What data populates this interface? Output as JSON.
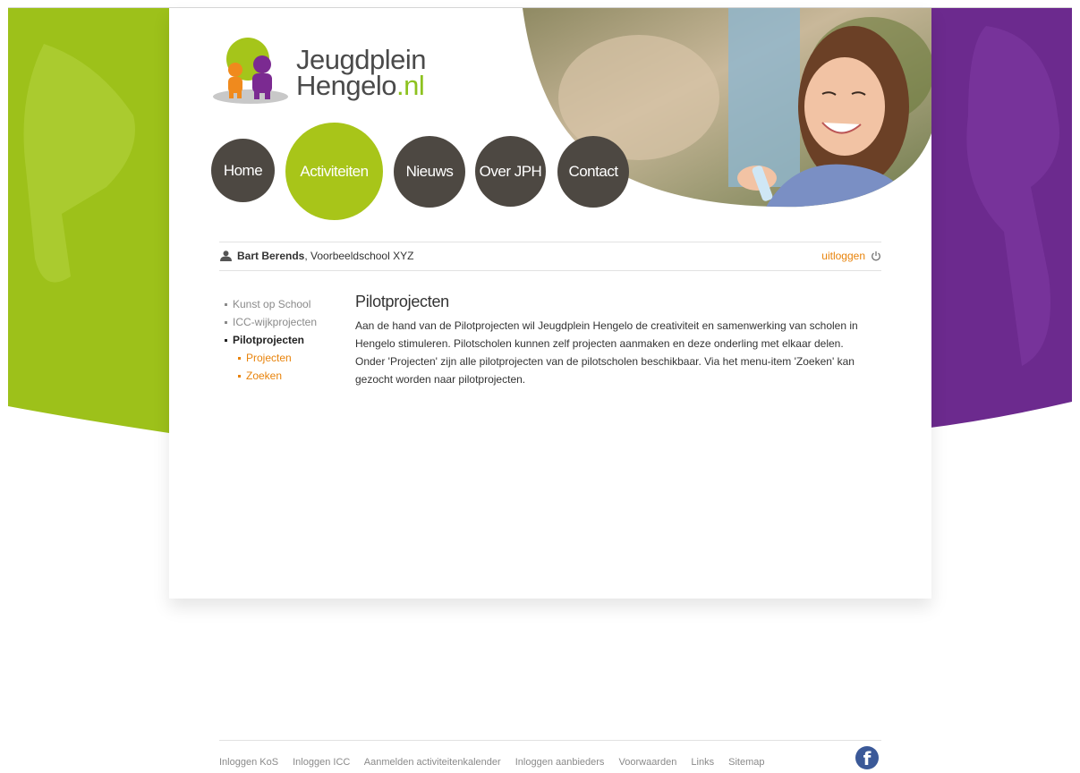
{
  "logo": {
    "line1": "Jeugdplein",
    "line2": "Hengelo",
    "suffix": ".nl"
  },
  "nav": [
    {
      "label": "Home",
      "active": false
    },
    {
      "label": "Activiteiten",
      "active": true
    },
    {
      "label": "Nieuws",
      "active": false
    },
    {
      "label": "Over JPH",
      "active": false
    },
    {
      "label": "Contact",
      "active": false
    }
  ],
  "user": {
    "name": "Bart Berends",
    "school": ", Voorbeeldschool XYZ",
    "logout": "uitloggen"
  },
  "sidebar": {
    "items": [
      {
        "label": "Kunst op School"
      },
      {
        "label": "ICC-wijkprojecten"
      },
      {
        "label": "Pilotprojecten"
      },
      {
        "label": "Projecten"
      },
      {
        "label": "Zoeken"
      }
    ]
  },
  "content": {
    "title": "Pilotprojecten",
    "body": "Aan de hand van de Pilotprojecten wil Jeugdplein Hengelo de creativiteit en samenwerking van scholen in Hengelo stimuleren. Pilotscholen kunnen zelf projecten aanmaken en deze onderling met elkaar delen. Onder 'Projecten' zijn alle pilotprojecten van de pilotscholen beschikbaar. Via het menu-item 'Zoeken' kan gezocht worden naar pilotprojecten."
  },
  "footer": {
    "links": [
      "Inloggen KoS",
      "Inloggen ICC",
      "Aanmelden activiteitenkalender",
      "Inloggen aanbieders",
      "Voorwaarden",
      "Links",
      "Sitemap"
    ]
  },
  "colors": {
    "green": "#a8c519",
    "purple": "#6a2a8c",
    "orange": "#e8830b",
    "dark": "#4d4842"
  }
}
